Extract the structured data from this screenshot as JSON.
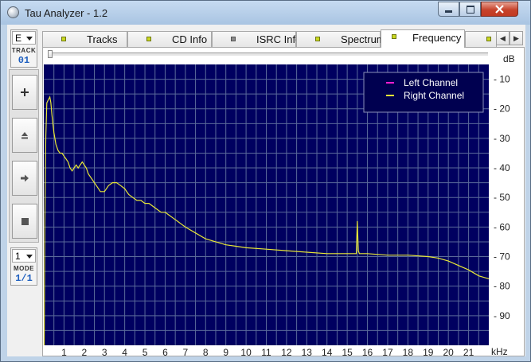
{
  "window": {
    "title": "Tau Analyzer - 1.2"
  },
  "sidebar": {
    "drive_select": "E",
    "track_label": "TRACK",
    "track_number": "01",
    "mode_select": "1",
    "mode_label": "MODE",
    "mode_value": "1/1"
  },
  "tabs": [
    {
      "label": "Tracks"
    },
    {
      "label": "CD Info"
    },
    {
      "label": "ISRC Info"
    },
    {
      "label": "Spectrum"
    },
    {
      "label": "Frequency"
    }
  ],
  "active_tab": "Frequency",
  "chart_data": {
    "type": "line",
    "xlabel": "kHz",
    "ylabel": "dB",
    "xlim": [
      0,
      22
    ],
    "ylim": [
      -100,
      -5
    ],
    "y_inverted": true,
    "grid": true,
    "legend_position": "top-right",
    "background_color": "#000060",
    "grid_color": "#5a6a9a",
    "x_ticks": [
      1,
      2,
      3,
      4,
      5,
      6,
      7,
      8,
      9,
      10,
      11,
      12,
      13,
      14,
      15,
      16,
      17,
      18,
      19,
      20,
      21
    ],
    "y_ticks": [
      -10,
      -20,
      -30,
      -40,
      -50,
      -60,
      -70,
      -80,
      -90
    ],
    "y_tick_labels": [
      "- 10",
      "- 20",
      "- 30",
      "- 40",
      "- 50",
      "- 60",
      "- 70",
      "- 80",
      "- 90"
    ],
    "series": [
      {
        "name": "Left Channel",
        "color": "#ff1fd0",
        "values": []
      },
      {
        "name": "Right Channel",
        "color": "#e8e836",
        "x": [
          0.02,
          0.05,
          0.1,
          0.15,
          0.22,
          0.3,
          0.35,
          0.4,
          0.5,
          0.6,
          0.7,
          0.8,
          0.9,
          1.0,
          1.1,
          1.2,
          1.3,
          1.4,
          1.5,
          1.6,
          1.7,
          1.8,
          1.9,
          2.0,
          2.1,
          2.2,
          2.4,
          2.6,
          2.8,
          3.0,
          3.2,
          3.4,
          3.6,
          3.8,
          4.0,
          4.2,
          4.4,
          4.6,
          4.8,
          5.0,
          5.2,
          5.4,
          5.6,
          5.8,
          6.0,
          6.2,
          6.4,
          6.6,
          6.8,
          7.0,
          7.5,
          8.0,
          8.5,
          9.0,
          9.5,
          10.0,
          11.0,
          12.0,
          13.0,
          14.0,
          15.0,
          15.45,
          15.5,
          15.52,
          15.55,
          15.6,
          16.0,
          17.0,
          18.0,
          19.0,
          19.5,
          20.0,
          20.5,
          21.0,
          21.5,
          22.0
        ],
        "values": [
          -100,
          -60,
          -30,
          -18,
          -17,
          -16,
          -18,
          -22,
          -28,
          -32,
          -34,
          -35,
          -35,
          -36,
          -37,
          -38,
          -40,
          -41,
          -40,
          -39,
          -40,
          -39,
          -38,
          -39,
          -40,
          -42,
          -44,
          -46,
          -48,
          -48,
          -46,
          -45,
          -45,
          -46,
          -47,
          -49,
          -50,
          -51,
          -51,
          -52,
          -52,
          -53,
          -54,
          -55,
          -55,
          -56,
          -57,
          -58,
          -59,
          -60,
          -62,
          -64,
          -65,
          -66,
          -66.5,
          -67,
          -67.5,
          -68,
          -68.5,
          -69,
          -69,
          -69,
          -58,
          -62,
          -68,
          -69,
          -69,
          -69.5,
          -69.5,
          -70,
          -70.5,
          -71.5,
          -73,
          -74.5,
          -76.5,
          -77.5
        ]
      }
    ]
  }
}
